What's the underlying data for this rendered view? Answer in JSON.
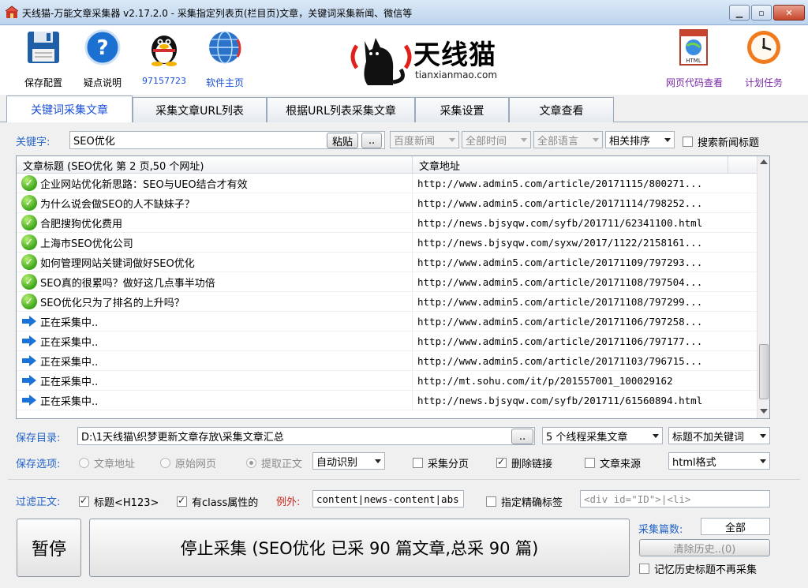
{
  "window": {
    "title": "天线猫-万能文章采集器 v2.17.2.0 - 采集指定列表页(栏目页)文章，关键词采集新闻、微信等",
    "min_label": "▁",
    "max_label": "▫",
    "close_label": "✕"
  },
  "toolbar": {
    "save_config": "保存配置",
    "help": "疑点说明",
    "qq": "97157723",
    "homepage": "软件主页",
    "web_code": "网页代码查看",
    "plan": "计划任务",
    "logo_name": "天线猫",
    "logo_url": "tianxianmao.com",
    "html_label": "HTML"
  },
  "tabs": [
    {
      "label": "关键词采集文章"
    },
    {
      "label": "采集文章URL列表"
    },
    {
      "label": "根据URL列表采集文章"
    },
    {
      "label": "采集设置"
    },
    {
      "label": "文章查看"
    }
  ],
  "keyword": {
    "label": "关键字:",
    "value": "SEO优化",
    "paste": "粘贴",
    "more": "..",
    "engine": "百度新闻",
    "time": "全部时间",
    "lang": "全部语言",
    "sort": "相关排序",
    "search_title": "搜索新闻标题"
  },
  "list": {
    "col_title": "文章标题  (SEO优化  第 2 页,50 个网址)",
    "col_url": "文章地址",
    "rows": [
      {
        "status": "done",
        "title": "企业网站优化新思路：SEO与UEO结合才有效",
        "url": "http://www.admin5.com/article/20171115/800271..."
      },
      {
        "status": "done",
        "title": "为什么说会做SEO的人不缺妹子？",
        "url": "http://www.admin5.com/article/20171114/798252..."
      },
      {
        "status": "done",
        "title": "合肥搜狗优化费用",
        "url": "http://news.bjsyqw.com/syfb/201711/62341100.html"
      },
      {
        "status": "done",
        "title": "上海市SEO优化公司",
        "url": "http://news.bjsyqw.com/syxw/2017/1122/2158161..."
      },
      {
        "status": "done",
        "title": "如何管理网站关键词做好SEO优化",
        "url": "http://www.admin5.com/article/20171109/797293..."
      },
      {
        "status": "done",
        "title": "SEO真的很累吗？做好这几点事半功倍",
        "url": "http://www.admin5.com/article/20171108/797504..."
      },
      {
        "status": "done",
        "title": "SEO优化只为了排名的上升吗？",
        "url": "http://www.admin5.com/article/20171108/797299..."
      },
      {
        "status": "pending",
        "title": "正在采集中..",
        "url": "http://www.admin5.com/article/20171106/797258..."
      },
      {
        "status": "pending",
        "title": "正在采集中..",
        "url": "http://www.admin5.com/article/20171106/797177..."
      },
      {
        "status": "pending",
        "title": "正在采集中..",
        "url": "http://www.admin5.com/article/20171103/796715..."
      },
      {
        "status": "pending",
        "title": "正在采集中..",
        "url": "http://mt.sohu.com/it/p/201557001_100029162"
      },
      {
        "status": "pending",
        "title": "正在采集中..",
        "url": "http://news.bjsyqw.com/syfb/201711/61560894.html"
      }
    ]
  },
  "save": {
    "dir_label": "保存目录:",
    "dir_value": "D:\\1天线猫\\织梦更新文章存放\\采集文章汇总",
    "browse": "..",
    "threads": "5 个线程采集文章",
    "title_mode": "标题不加关键词",
    "opt_label": "保存选项:",
    "opt_url": "文章地址",
    "opt_raw": "原始网页",
    "opt_extract": "提取正文",
    "detect": "自动识别",
    "paging": "采集分页",
    "remove_links": "删除链接",
    "source": "文章来源",
    "format": "html格式"
  },
  "filter": {
    "label": "过滤正文:",
    "title_tag": "标题<H123>",
    "class_attr": "有class属性的",
    "except_label": "例外:",
    "except_value": "content|news-content|abs",
    "exact_tag": "指定精确标签",
    "tag_value": "<div id=\"ID\">|<li>"
  },
  "bottom": {
    "pause": "暂停",
    "stop": "停止采集 (SEO优化 已采 90 篇文章,总采 90 篇)",
    "count_label": "采集篇数:",
    "count_value": "全部",
    "clear_history": "清除历史..(0)",
    "remember": "记忆历史标题不再采集"
  },
  "colors": {
    "accent": "#2463c9",
    "tab_active": "#1a4fd6",
    "red_label": "#d0261b"
  }
}
